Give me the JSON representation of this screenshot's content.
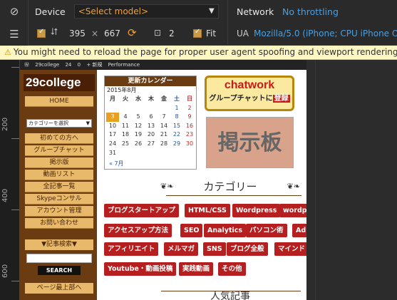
{
  "devtools": {
    "device_label": "Device",
    "model_placeholder": "<Select model>",
    "network_label": "Network",
    "network_value": "No throttling",
    "width": "395",
    "times": "×",
    "height": "667",
    "zoom": "2",
    "fit_label": "Fit",
    "ua_label": "UA",
    "ua_value": "Mozilla/5.0 (iPhone; CPU iPhone O"
  },
  "warning": "You might need to reload the page for proper user agent spoofing and viewport rendering.",
  "ruler": {
    "labels": [
      "200",
      "400",
      "600"
    ]
  },
  "adminbar": {
    "items": [
      "29college",
      "24",
      "0",
      "+ 新規",
      "Performance"
    ]
  },
  "site": {
    "logo": "29college",
    "nav": [
      "HOME",
      "初めての方へ",
      "グループチャット",
      "掲示版",
      "動画リスト",
      "全記事一覧",
      "Skypeコンサル",
      "アカウント管理",
      "お問い合わせ"
    ],
    "category_select": "カテゴリーを選択",
    "search_title": "▼記事検索▼",
    "search_button": "SEARCH",
    "page_top": "ページ最上部へ"
  },
  "calendar": {
    "title": "更新カレンダー",
    "month": "2015年8月",
    "weekdays": [
      "月",
      "火",
      "水",
      "木",
      "金",
      "土",
      "日"
    ],
    "days": [
      "",
      "",
      "",
      "",
      "",
      "1",
      "2",
      "3",
      "4",
      "5",
      "6",
      "7",
      "8",
      "9",
      "10",
      "11",
      "12",
      "13",
      "14",
      "15",
      "16",
      "17",
      "18",
      "19",
      "20",
      "21",
      "22",
      "23",
      "24",
      "25",
      "26",
      "27",
      "28",
      "29",
      "30",
      "31"
    ],
    "prev": "« 7月"
  },
  "banner": {
    "title": "chatwork",
    "sub": "グループチャットに",
    "reg": "登録"
  },
  "board": "掲示板",
  "category_heading": "カテゴリー",
  "tags": [
    "ブログスタートアップ",
    "HTML/CSS",
    "Wordpress",
    "wordp",
    "アクセスアップ方法",
    "SEO",
    "Analytics",
    "パソコン術",
    "Ad",
    "アフィリエイト",
    "メルマガ",
    "SNS",
    "ブログ全般",
    "マインド",
    "Youtube・動画投稿",
    "実践動画",
    "その他"
  ],
  "bottom_heading": "人気記事"
}
